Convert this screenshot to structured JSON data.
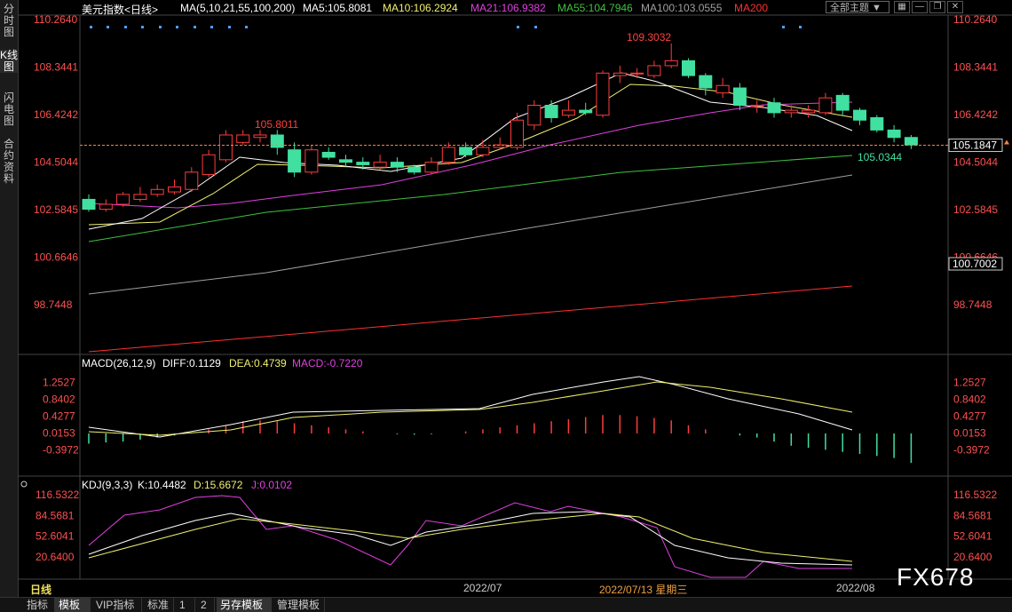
{
  "sidebar": [
    {
      "label": "分时图",
      "active": false
    },
    {
      "label": "K线图",
      "active": true
    },
    {
      "label": "闪电图",
      "active": false
    },
    {
      "label": "合约资料",
      "active": false
    }
  ],
  "header": {
    "symbol": "美元指数<日线>",
    "ma_params": "MA(5,10,21,55,100,200)",
    "ma5": "MA5:105.8081",
    "ma10": "MA10:106.2924",
    "ma21": "MA21:106.9382",
    "ma55": "MA55:104.7946",
    "ma100": "MA100:103.0555",
    "ma200": "MA200",
    "theme_button": "全部主题"
  },
  "toolbar_icons": [
    "grid-icon",
    "minus-icon",
    "restore-icon",
    "close-icon"
  ],
  "colors": {
    "up": "#ff3c3c",
    "down": "#40e0a0",
    "ma5": "#ffffff",
    "ma10": "#f0f070",
    "ma21": "#e040e0",
    "ma55": "#40c040",
    "ma100": "#a0a0a0",
    "ma200": "#ff3030",
    "axis_text": "#ff5050",
    "dea": "#f0f070",
    "kdj_j": "#e040e0"
  },
  "price_axis": {
    "ticks": [
      "110.2640",
      "108.3441",
      "106.4242",
      "104.5044",
      "102.5845",
      "100.6646",
      "98.7448"
    ],
    "current_price": "105.1847",
    "right_marker": "100.7002",
    "high_label": "109.3032",
    "mid_high_label": "105.8011",
    "low_label": "105.0344"
  },
  "macd": {
    "title": "MACD(26,12,9)",
    "diff": "DIFF:0.1129",
    "dea": "DEA:0.4739",
    "macd": "MACD:-0.7220",
    "ticks": [
      "1.2527",
      "0.8402",
      "0.4277",
      "0.0153",
      "-0.3972"
    ]
  },
  "kdj": {
    "title": "KDJ(9,3,3)",
    "k": "K:10.4482",
    "d": "D:15.6672",
    "j": "J:0.0102",
    "ticks": [
      "116.5322",
      "84.5681",
      "52.6041",
      "20.6400"
    ]
  },
  "time_axis": {
    "period_label": "日线",
    "labels": [
      "2022/07",
      "2022/07/13 星期三",
      "2022/08"
    ]
  },
  "bottom_tabs": [
    {
      "label": "指标",
      "active": false
    },
    {
      "label": "模板",
      "active": true
    },
    {
      "label": "VIP指标",
      "active": false
    },
    {
      "label": "标准",
      "active": false
    },
    {
      "label": "1",
      "active": false
    },
    {
      "label": "2",
      "active": false
    },
    {
      "label": "另存模板",
      "active": true
    },
    {
      "label": "管理模板",
      "active": false
    }
  ],
  "watermark": "FX678",
  "chart_data": {
    "type": "candlestick",
    "candles": [
      [
        103.0,
        102.6,
        103.2,
        102.5
      ],
      [
        102.6,
        102.8,
        103.0,
        102.5
      ],
      [
        102.8,
        103.2,
        103.3,
        102.7
      ],
      [
        103.0,
        103.2,
        103.5,
        102.9
      ],
      [
        103.2,
        103.4,
        103.6,
        103.1
      ],
      [
        103.3,
        103.5,
        103.8,
        103.2
      ],
      [
        103.4,
        104.1,
        104.3,
        103.3
      ],
      [
        104.0,
        104.8,
        105.0,
        103.9
      ],
      [
        104.6,
        105.6,
        105.8,
        104.5
      ],
      [
        105.3,
        105.6,
        105.8,
        105.2
      ],
      [
        105.5,
        105.6,
        105.8,
        105.3
      ],
      [
        105.6,
        105.1,
        105.8,
        104.8
      ],
      [
        105.0,
        104.1,
        105.3,
        103.9
      ],
      [
        104.1,
        105.0,
        105.2,
        104.0
      ],
      [
        104.9,
        104.7,
        105.1,
        104.6
      ],
      [
        104.6,
        104.5,
        104.8,
        104.3
      ],
      [
        104.5,
        104.4,
        104.7,
        104.2
      ],
      [
        104.3,
        104.5,
        104.8,
        104.2
      ],
      [
        104.5,
        104.3,
        104.7,
        104.1
      ],
      [
        104.3,
        104.1,
        104.4,
        104.0
      ],
      [
        104.1,
        104.5,
        104.7,
        104.0
      ],
      [
        104.5,
        105.1,
        105.3,
        104.4
      ],
      [
        105.1,
        104.8,
        105.3,
        104.7
      ],
      [
        104.8,
        105.1,
        105.4,
        104.7
      ],
      [
        105.1,
        105.2,
        105.5,
        105.0
      ],
      [
        105.1,
        106.2,
        106.5,
        105.0
      ],
      [
        106.0,
        106.8,
        107.0,
        105.8
      ],
      [
        106.8,
        106.3,
        107.0,
        106.1
      ],
      [
        106.4,
        106.6,
        107.0,
        106.3
      ],
      [
        106.6,
        106.5,
        106.9,
        106.4
      ],
      [
        106.4,
        108.1,
        108.2,
        106.3
      ],
      [
        108.0,
        108.1,
        108.4,
        107.7
      ],
      [
        108.1,
        108.1,
        108.3,
        107.9
      ],
      [
        108.0,
        108.4,
        108.6,
        107.9
      ],
      [
        108.4,
        108.6,
        109.3,
        108.3
      ],
      [
        108.6,
        108.0,
        108.7,
        107.9
      ],
      [
        108.0,
        107.5,
        108.1,
        107.2
      ],
      [
        107.3,
        107.6,
        107.9,
        107.1
      ],
      [
        107.5,
        106.8,
        107.7,
        106.6
      ],
      [
        106.8,
        106.8,
        107.0,
        106.5
      ],
      [
        106.9,
        106.5,
        107.1,
        106.3
      ],
      [
        106.5,
        106.6,
        106.8,
        106.3
      ],
      [
        106.5,
        106.6,
        106.8,
        106.3
      ],
      [
        106.5,
        107.1,
        107.3,
        106.4
      ],
      [
        107.2,
        106.6,
        107.3,
        106.4
      ],
      [
        106.6,
        106.2,
        106.7,
        106.0
      ],
      [
        106.3,
        105.8,
        106.4,
        105.7
      ],
      [
        105.8,
        105.5,
        106.0,
        105.3
      ],
      [
        105.5,
        105.2,
        105.6,
        105.03
      ]
    ],
    "ma_series": [
      "MA5",
      "MA10",
      "MA21",
      "MA55",
      "MA100",
      "MA200"
    ],
    "macd_hist": [
      -0.25,
      -0.22,
      -0.2,
      -0.15,
      -0.1,
      -0.05,
      0.0,
      0.1,
      0.2,
      0.3,
      0.32,
      0.3,
      0.25,
      0.2,
      0.15,
      0.1,
      0.05,
      0.0,
      -0.02,
      -0.03,
      -0.02,
      0.0,
      0.05,
      0.1,
      0.15,
      0.2,
      0.25,
      0.3,
      0.35,
      0.4,
      0.45,
      0.45,
      0.42,
      0.38,
      0.32,
      0.2,
      0.1,
      0.0,
      -0.05,
      -0.1,
      -0.2,
      -0.3,
      -0.35,
      -0.4,
      -0.45,
      -0.5,
      -0.55,
      -0.6,
      -0.72
    ],
    "ylim": [
      98.0,
      110.5
    ]
  }
}
